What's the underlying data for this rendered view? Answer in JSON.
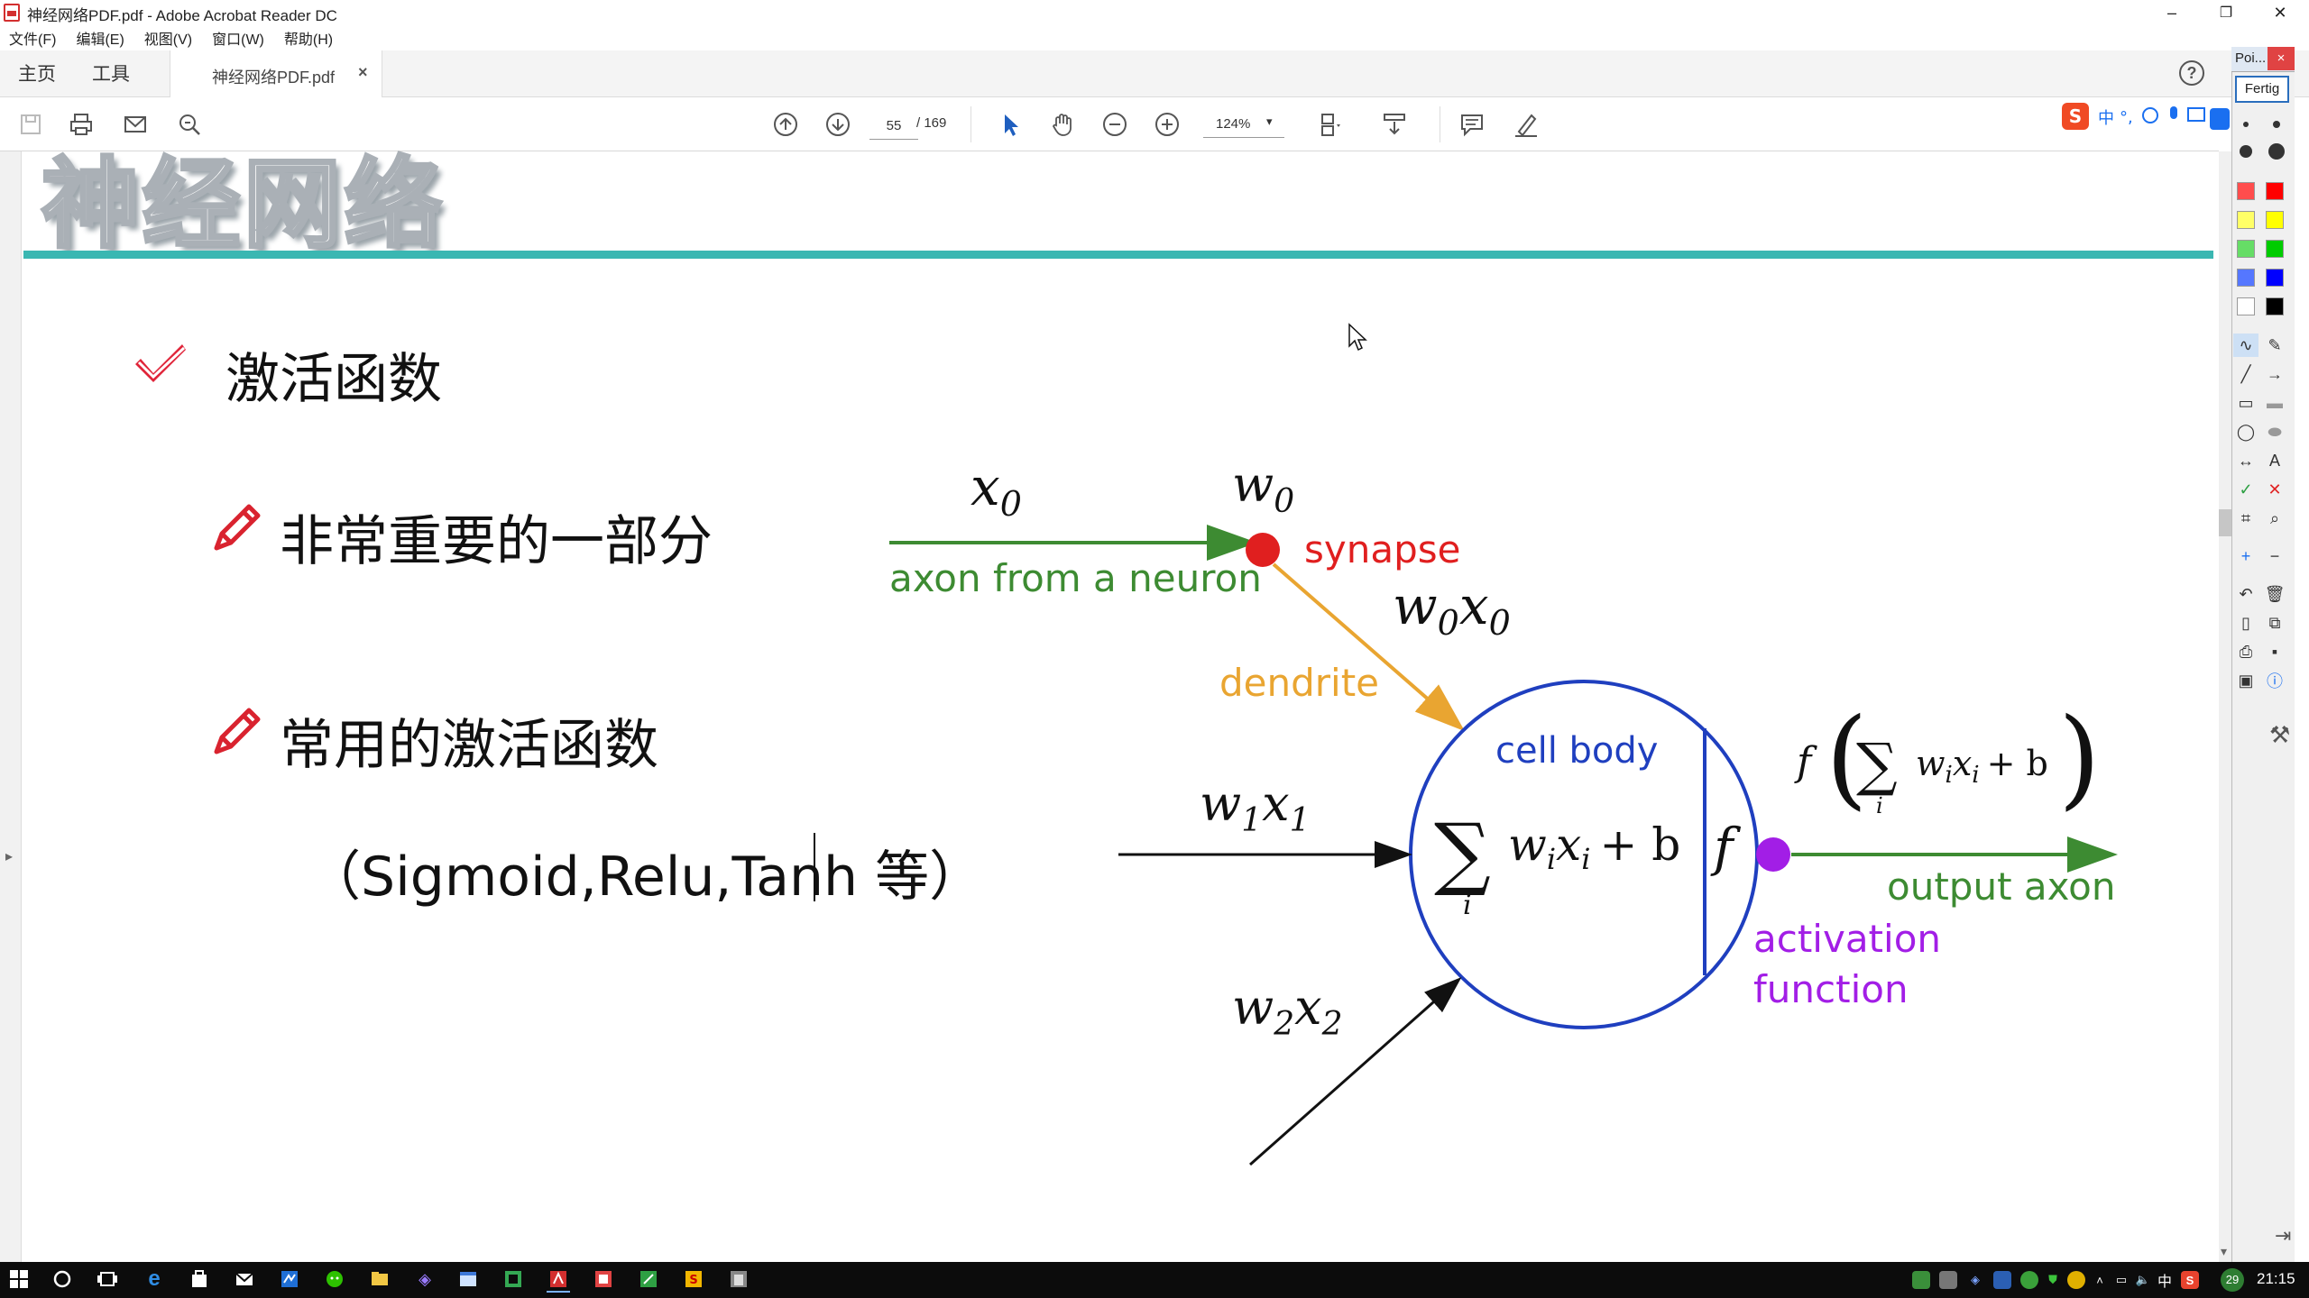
{
  "window": {
    "title": "神经网络PDF.pdf - Adobe Acrobat Reader DC",
    "minimize": "–",
    "restore": "❐",
    "close": "✕"
  },
  "menu": [
    "文件(F)",
    "编辑(E)",
    "视图(V)",
    "窗口(W)",
    "帮助(H)"
  ],
  "tabs": {
    "home": "主页",
    "tools": "工具",
    "document": "神经网络PDF.pdf",
    "close": "×",
    "help": "?"
  },
  "toolbar": {
    "page_current": "55",
    "page_total": "/ 169",
    "zoom": "124%",
    "zoom_caret": "▾"
  },
  "slide": {
    "title": "神经网络",
    "heading": "激活函数",
    "bullet1": "非常重要的一部分",
    "bullet2": "常用的激活函数",
    "examples": "（Sigmoid,Relu,Tanh 等）"
  },
  "diagram": {
    "input0": "x",
    "input0_sub": "0",
    "weight0": "w",
    "weight0_sub": "0",
    "synapse": "synapse",
    "axon_from": "axon from a neuron",
    "w0x0": "w",
    "w0x0_sub1": "0",
    "w0x0_x": "x",
    "w0x0_sub2": "0",
    "dendrite": "dendrite",
    "cell_body": "cell body",
    "w1x1_w": "w",
    "w1x1_sub1": "1",
    "w1x1_x": "x",
    "w1x1_sub2": "1",
    "w2x2_w": "w",
    "w2x2_sub1": "2",
    "w2x2_x": "x",
    "w2x2_sub2": "2",
    "sum_symbol": "∑",
    "sum_index": "i",
    "sum_body": "w",
    "sum_body_sub": "i",
    "sum_body_x": "x",
    "sum_body_x_sub": "i",
    "sum_plus_b": "+ b",
    "f_symbol": "f",
    "output_formula_f": "f",
    "output_formula_open": "(",
    "output_formula_close": ")",
    "output_axon": "output axon",
    "activation": "activation",
    "function": "function",
    "colors": {
      "green": "#3d8b32",
      "red": "#e01f1f",
      "orange": "#e9a531",
      "blue": "#1f3fbf",
      "purple": "#a21ee6"
    }
  },
  "palette": {
    "title": "Poi...",
    "close": "×",
    "done": "Fertig",
    "colors": [
      "#ff4d4d",
      "#ff0000",
      "#ffff66",
      "#ffff00",
      "#66dd66",
      "#00cc00",
      "#5577ff",
      "#0000ff",
      "#ffffff",
      "#000000"
    ]
  },
  "taskbar": {
    "clock": "21:15",
    "badge": "29",
    "ime": "中"
  }
}
